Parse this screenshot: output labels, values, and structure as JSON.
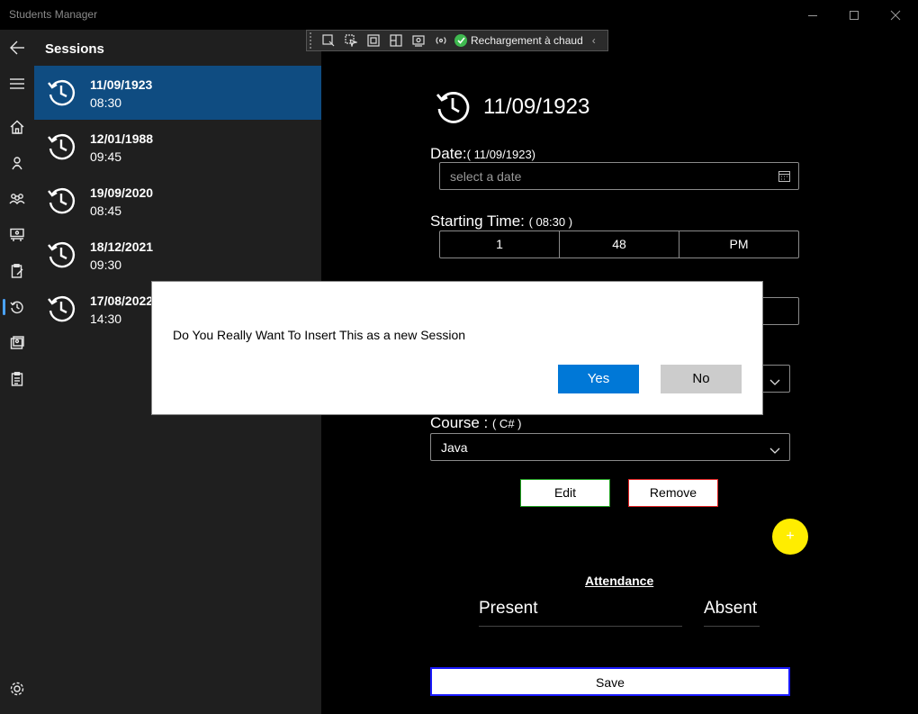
{
  "window": {
    "title": "Students Manager"
  },
  "pane": {
    "title": "Sessions"
  },
  "sessions": [
    {
      "date": "11/09/1923",
      "time": "08:30"
    },
    {
      "date": "12/01/1988",
      "time": "09:45"
    },
    {
      "date": "19/09/2020",
      "time": "08:45"
    },
    {
      "date": "18/12/2021",
      "time": "09:30"
    },
    {
      "date": "17/08/2022",
      "time": "14:30"
    }
  ],
  "debug_toolbar": {
    "hot_reload_label": "Rechargement à chaud"
  },
  "detail": {
    "title": "11/09/1923",
    "date_label": "Date:",
    "date_value": "( 11/09/1923)",
    "date_placeholder": "select a date",
    "time_label": "Starting Time: ",
    "time_value": "( 08:30 )",
    "time_hour": "1",
    "time_minute": "48",
    "time_period": "PM",
    "course_label": "Course : ",
    "course_value": "( C# )",
    "course_selected": "Java",
    "edit_label": "Edit",
    "remove_label": "Remove",
    "fab_label": "+",
    "attendance_title": "Attendance",
    "present_label": "Present",
    "absent_label": "Absent",
    "save_label": "Save"
  },
  "dialog": {
    "message": "Do You Really Want To Insert This as a new Session",
    "yes_label": "Yes",
    "no_label": "No"
  },
  "colors": {
    "accent": "#0078d7",
    "selected_item": "#0f4c81",
    "fab": "#ffed00",
    "edit_border": "#1e9e1e",
    "remove_border": "#e02020",
    "save_border": "#1a1aff"
  }
}
